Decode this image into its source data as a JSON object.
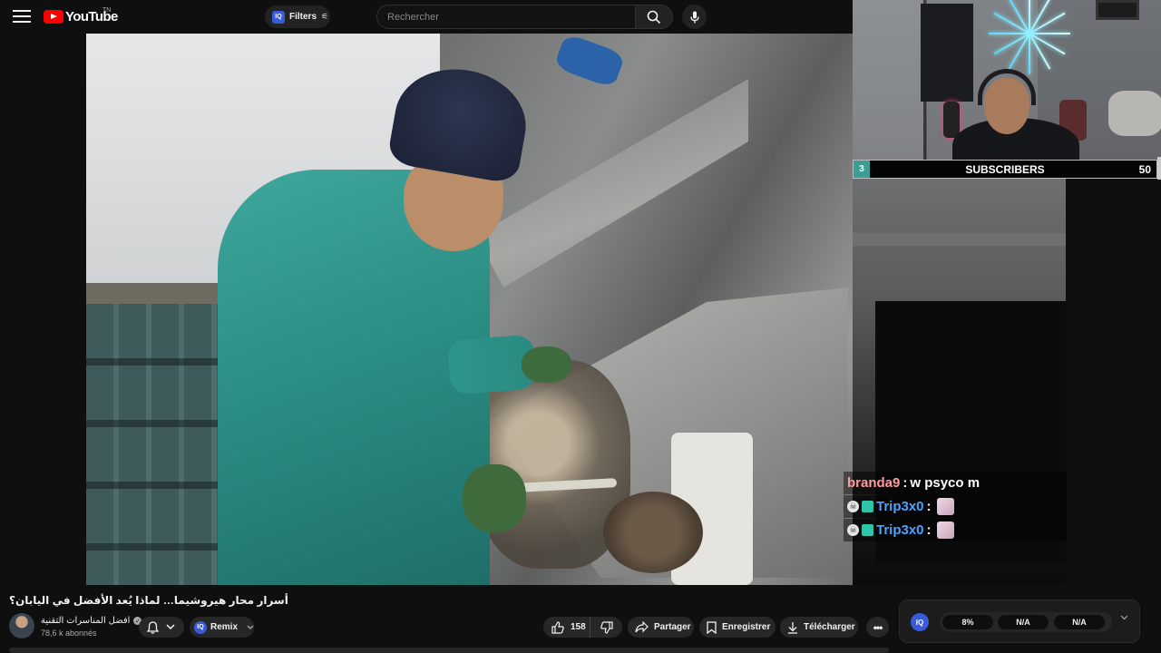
{
  "topbar": {
    "logo_text": "YouTube",
    "logo_suffix": "TN",
    "filters_label": "Filters",
    "filters_badge": "IQ",
    "search_placeholder": "Rechercher"
  },
  "webcam": {
    "subscriber_count": "3",
    "subscriber_label": "SUBSCRIBERS",
    "subscriber_goal": "50"
  },
  "chat": {
    "messages": [
      {
        "user": "branda9",
        "text": "w psyco m",
        "user_color": "#ff9aa0"
      },
      {
        "user": "Trip3x0",
        "text": "",
        "user_color": "#4aa3ff"
      },
      {
        "user": "Trip3x0",
        "text": "",
        "user_color": "#4aa3ff"
      }
    ]
  },
  "video": {
    "title": "أسرار محار هيروشيما… لماذا يُعد الأفضل في اليابان؟",
    "channel_name": "افضل المناسرات التقنية",
    "subscribers": "78,6 k abonnés"
  },
  "actions": {
    "remix_label": "Remix",
    "remix_badge": "IQ",
    "like_count": "158",
    "share_label": "Partager",
    "save_label": "Enregistrer",
    "download_label": "Télécharger",
    "more_label": "•••"
  },
  "extension": {
    "badge": "IQ",
    "stats": [
      "8%",
      "N/A",
      "N/A"
    ]
  },
  "colors": {
    "accent_red": "#ff0000",
    "iq_blue": "#3a5bd9",
    "subs_teal": "#3a9e96"
  }
}
